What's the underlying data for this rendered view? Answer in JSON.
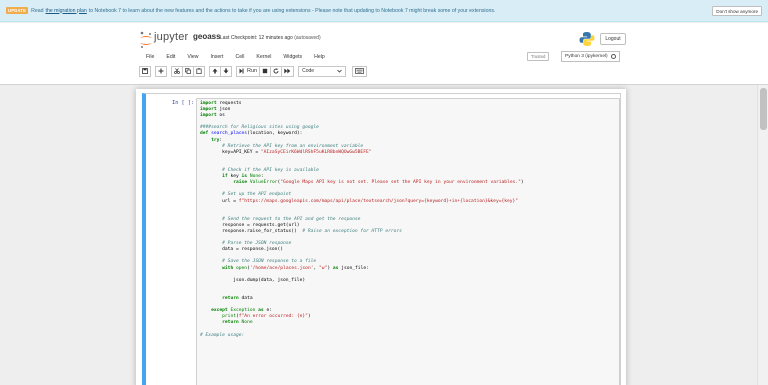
{
  "banner": {
    "badge": "UPDATE",
    "text_before": "Read",
    "link": "the migration plan",
    "text_after": "to Notebook 7 to learn about the new features and the actions to take if you are using extensions - Please note that updating to Notebook 7 might break some of your extensions.",
    "dismiss_label": "Don't show anymore"
  },
  "header": {
    "logo_text": "jupyter",
    "notebook_name": "geoass",
    "checkpoint_label": "Last Checkpoint: 12 minutes ago",
    "autosave_status": "(autosaved)",
    "logout_label": "Logout"
  },
  "menu": [
    "File",
    "Edit",
    "View",
    "Insert",
    "Cell",
    "Kernel",
    "Widgets",
    "Help"
  ],
  "status": {
    "trusted": "Trusted",
    "kernel": "Python 3 (ipykernel)"
  },
  "toolbar": {
    "run_label": "Run",
    "cell_type": "Code",
    "icons": [
      "save-icon",
      "add-cell-icon",
      "cut-icon",
      "copy-icon",
      "paste-icon",
      "move-up-icon",
      "move-down-icon",
      "run-icon",
      "stop-icon",
      "restart-icon",
      "fast-forward-icon",
      "keyboard-icon"
    ]
  },
  "cell": {
    "prompt": "In [ ]:",
    "code": "import requests\nimport json\nimport os\n\n####search for Religious sites using google\ndef search_places(location, keyword):\n    try:\n        # Retrieve the API key from an environment variable\n        key=API_KEY = \"AIzaSyCEirK6WdlRShF5uKLR8bnWQOwGw5BEFE\"\n\n\n        # Check if the API key is available\n        if key is None:\n            raise ValueError(\"Google Maps API key is not set. Please set the API key in your environment variables.\")\n\n        # Set up the API endpoint\n        url = f\"https://maps.googleapis.com/maps/api/place/textsearch/json?query={keyword}+in+{location}&key={key}\"\n\n\n        # Send the request to the API and get the response\n        response = requests.get(url)\n        response.raise_for_status()  # Raise an exception for HTTP errors\n\n        # Parse the JSON response\n        data = response.json()\n\n        # Save the JSON response to a file\n        with open('/home/ace/places.json', \"w\") as json_file:\n\n            json.dump(data, json_file)\n\n\n        return data\n\n    except Exception as e:\n        print(f\"An error occurred: {e}\")\n        return None\n\n# Example usage:"
  },
  "colors": {
    "banner_bg": "#d9edf7",
    "banner_text": "#31708f",
    "cell_selected_border": "#42a5f5",
    "prompt": "#303f9f",
    "keyword": "#008000",
    "comment": "#408080",
    "string": "#ba2121"
  }
}
